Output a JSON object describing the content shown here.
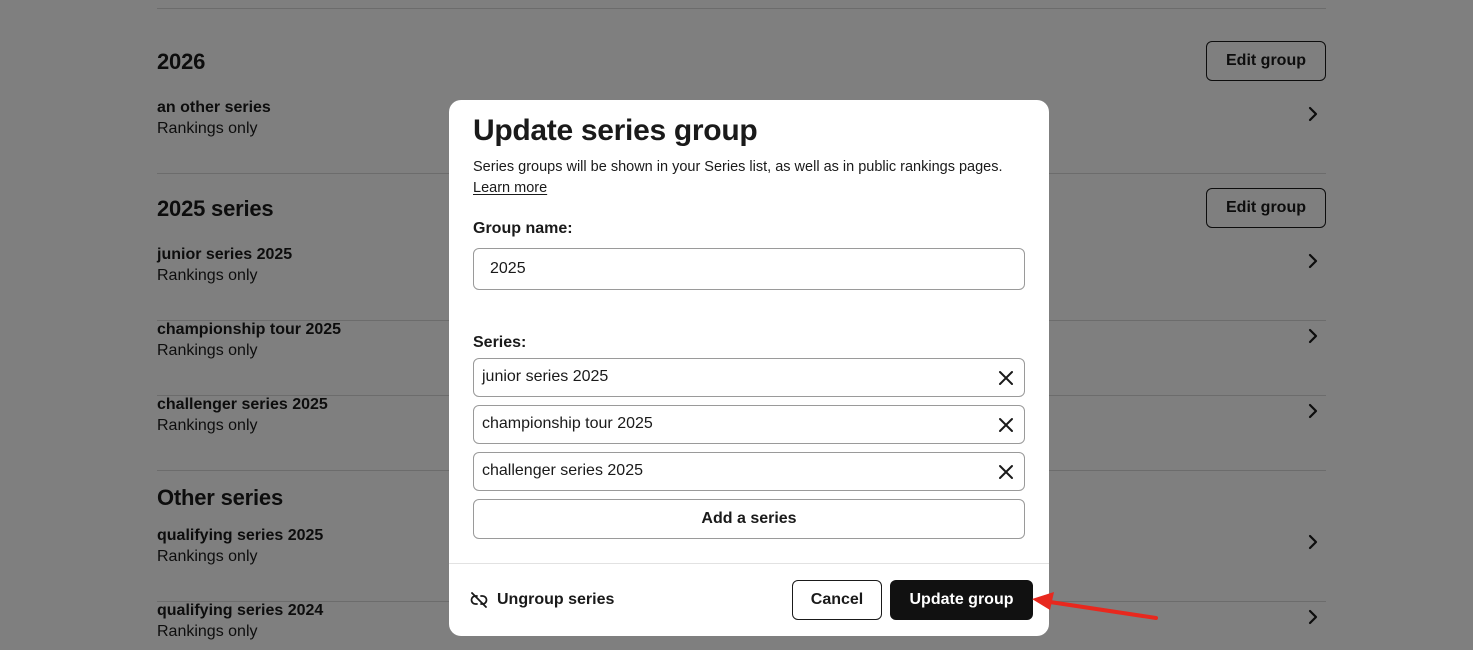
{
  "background": {
    "groups": [
      {
        "title": "2026",
        "edit_label": "Edit group",
        "series": [
          {
            "name": "an other series",
            "sub": "Rankings only"
          }
        ]
      },
      {
        "title": "2025 series",
        "edit_label": "Edit group",
        "series": [
          {
            "name": "junior series 2025",
            "sub": "Rankings only"
          },
          {
            "name": "championship tour 2025",
            "sub": "Rankings only"
          },
          {
            "name": "challenger series 2025",
            "sub": "Rankings only"
          }
        ]
      },
      {
        "title": "Other series",
        "series": [
          {
            "name": "qualifying series 2025",
            "sub": "Rankings only"
          },
          {
            "name": "qualifying series 2024",
            "sub": "Rankings only"
          }
        ]
      }
    ]
  },
  "modal": {
    "title": "Update series group",
    "description": "Series groups will be shown in your Series list, as well as in public rankings pages.",
    "learn_more": "Learn more",
    "group_name_label": "Group name:",
    "group_name_value": "2025",
    "series_label": "Series:",
    "series_items": [
      {
        "name": "junior series 2025"
      },
      {
        "name": "championship tour 2025"
      },
      {
        "name": "challenger series 2025"
      }
    ],
    "add_series_label": "Add a series",
    "ungroup_label": "Ungroup series",
    "cancel_label": "Cancel",
    "update_label": "Update group"
  },
  "colors": {
    "primary_button": "#111111",
    "annotation_arrow": "#e8281e",
    "overlay": "rgba(0,0,0,0.5)"
  },
  "icons": {
    "row_chevron": "chevron-right-icon",
    "remove": "close-icon",
    "ungroup": "unlink-icon"
  }
}
